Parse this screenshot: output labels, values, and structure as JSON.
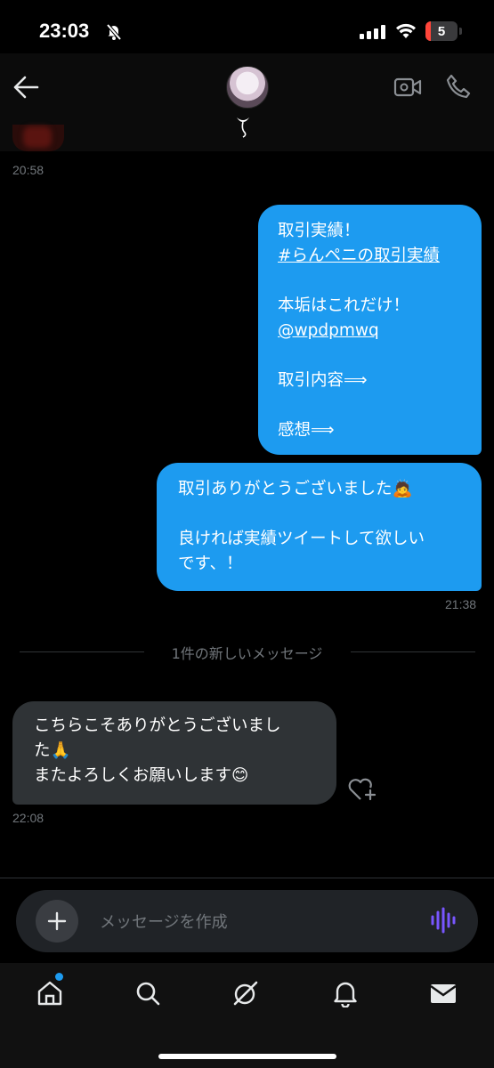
{
  "status_bar": {
    "time": "23:03",
    "battery": "5"
  },
  "old_message": {
    "time": "20:58"
  },
  "messages": [
    {
      "direction": "outgoing",
      "lines": [
        "取引実績！",
        "#らんペニの取引実績",
        "",
        "本垢はこれだけ！",
        "@wpdpmwq",
        "",
        "取引内容⟹",
        "",
        "感想⟹"
      ]
    },
    {
      "direction": "outgoing",
      "lines": [
        "取引ありがとうございました🙇",
        "",
        "良ければ実績ツイートして欲しい",
        "です、！"
      ],
      "time": "21:38"
    },
    {
      "direction": "incoming",
      "lines": [
        "こちらこそありがとうございまし",
        "た🙏",
        "またよろしくお願いします😊"
      ],
      "time": "22:08"
    }
  ],
  "divider": "1件の新しいメッセージ",
  "composer": {
    "placeholder": "メッセージを作成"
  },
  "nav": [
    "home-icon",
    "search-icon",
    "grok-icon",
    "notifications-icon",
    "messages-icon"
  ],
  "colors": {
    "accent": "#1d9bf0",
    "incoming_bubble": "#2f3336",
    "voice": "#7856ff"
  }
}
